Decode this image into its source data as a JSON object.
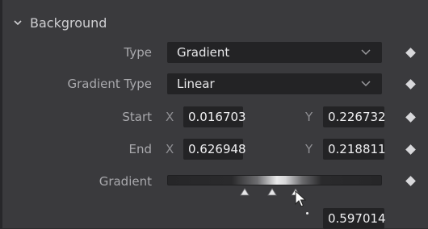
{
  "section": {
    "title": "Background",
    "icon": "chevron-down-icon"
  },
  "type_row": {
    "label": "Type",
    "value": "Gradient"
  },
  "gradient_type_row": {
    "label": "Gradient Type",
    "value": "Linear"
  },
  "start_row": {
    "label": "Start",
    "x_label": "X",
    "x_value": "0.016703",
    "y_label": "Y",
    "y_value": "0.226732"
  },
  "end_row": {
    "label": "End",
    "x_label": "X",
    "x_value": "0.626948",
    "y_label": "Y",
    "y_value": "0.218811"
  },
  "gradient_row": {
    "label": "Gradient",
    "stops": [
      0.36,
      0.49,
      0.597
    ],
    "selected_stop_value": "0.597014"
  },
  "colors": {
    "panel_bg": "#3a3a3d",
    "field_bg": "#232325",
    "label": "#a9a9ad",
    "value": "#f0f0f2"
  }
}
